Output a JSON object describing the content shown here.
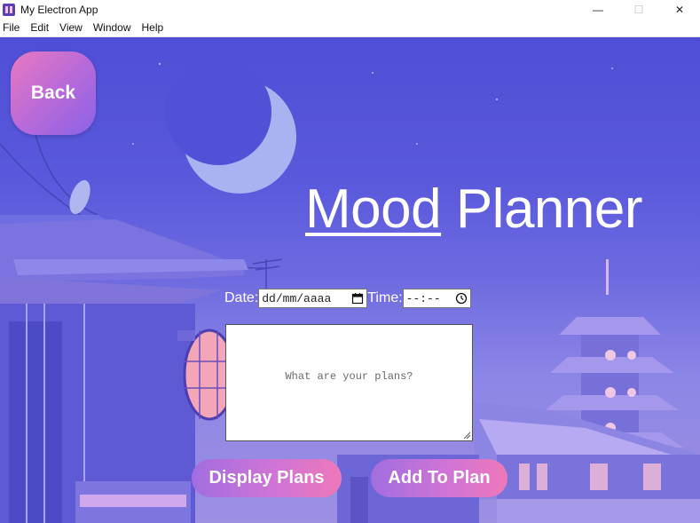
{
  "window": {
    "title": "My Electron App",
    "controls": {
      "minimize": "—",
      "maximize": "☐",
      "close": "✕"
    }
  },
  "menu": [
    "File",
    "Edit",
    "View",
    "Window",
    "Help"
  ],
  "page": {
    "back_label": "Back",
    "title_word1": "Mood",
    "title_word2": " Planner",
    "date_label": "Date:",
    "date_placeholder": "dd/mm/aaaa",
    "time_label": "Time:",
    "time_placeholder": "--:--",
    "plans_placeholder": "What are your plans?",
    "display_button": "Display Plans",
    "add_button": "Add To Plan"
  },
  "colors": {
    "sky_top": "#4f4fd6",
    "button_gradient_start": "#a26de0",
    "button_gradient_end": "#ee78b9",
    "moon": "#a9b3f2"
  },
  "icons": {
    "calendar": "calendar-icon",
    "clock": "clock-icon"
  }
}
